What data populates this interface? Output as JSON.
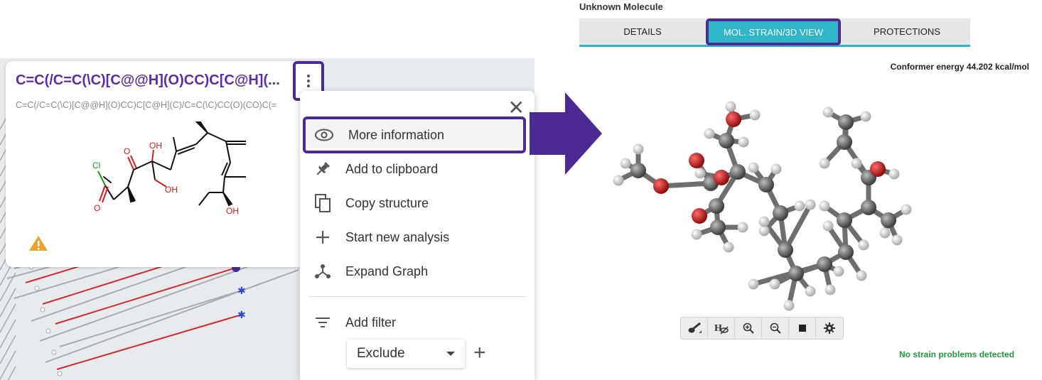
{
  "molecule_card": {
    "title": "C=C(/C=C(\\C)[C@@H](O)CC)C[C@H](...",
    "smiles": "C=C(/C=C(\\C)[C@@H](O)CC)C[C@H](C)/C=C(\\C)CC(O)(CO)C(=",
    "structure_labels": {
      "cl": "Cl",
      "o": "O",
      "oh1": "OH",
      "oh2": "OH",
      "oh3": "OH"
    }
  },
  "context_menu": {
    "items": [
      {
        "label": "More information",
        "icon": "eye-icon"
      },
      {
        "label": "Add to clipboard",
        "icon": "pin-icon"
      },
      {
        "label": "Copy structure",
        "icon": "copy-icon"
      },
      {
        "label": "Start new analysis",
        "icon": "plus-icon"
      },
      {
        "label": "Expand Graph",
        "icon": "graph-icon"
      }
    ],
    "filter": {
      "label": "Add filter",
      "selected": "Exclude"
    }
  },
  "right_panel": {
    "title": "Unknown Molecule",
    "tabs": [
      "DETAILS",
      "MOL. STRAIN/3D VIEW",
      "PROTECTIONS"
    ],
    "active_tab": "MOL. STRAIN/3D VIEW",
    "conformer_energy": "Conformer energy 44.202 kcal/mol",
    "strain_status": "No strain problems detected",
    "toolbar_icons": [
      "style-brush-icon",
      "hydrogen-toggle-icon",
      "zoom-in-icon",
      "zoom-out-icon",
      "background-icon",
      "settings-icon"
    ]
  },
  "colors": {
    "accent_purple": "#4b2a93",
    "tab_active": "#2fb6c9",
    "title_purple": "#5a2ea6",
    "success_green": "#1e9b3a",
    "edge_red": "#d42a2a",
    "oxygen_red": "#d41c1c"
  }
}
